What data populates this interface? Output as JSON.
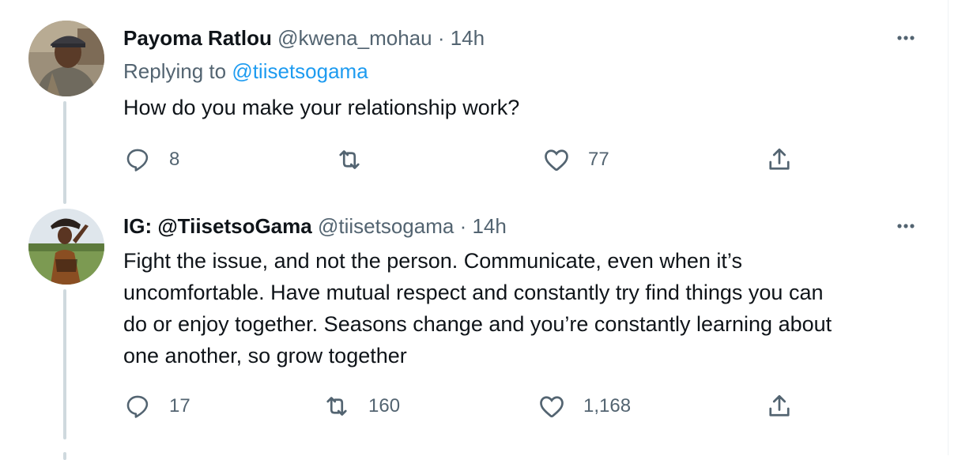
{
  "tweets": [
    {
      "name": "Payoma Ratlou",
      "handle": "@kwena_mohau",
      "separator": "·",
      "time": "14h",
      "replying_prefix": "Replying to",
      "replying_to": "@tiisetsogama",
      "text": "How do you make your relationship work?",
      "reply_count": "8",
      "retweet_count": "",
      "like_count": "77"
    },
    {
      "name": "IG: @TiisetsoGama",
      "handle": "@tiisetsogama",
      "separator": "·",
      "time": "14h",
      "text_lines": [
        "Fight the issue, and not the person. Communicate, even when it’s",
        "uncomfortable. Have mutual respect and constantly try find things you can",
        "do or enjoy together. Seasons change and you’re constantly learning about",
        "one another, so grow together"
      ],
      "reply_count": "17",
      "retweet_count": "160",
      "like_count": "1,168"
    }
  ],
  "colors": {
    "text": "#0f1419",
    "secondary": "#536471",
    "link": "#1d9bf0",
    "thread_line": "#cfd9de"
  },
  "icons": {
    "reply": "reply-icon",
    "retweet": "retweet-icon",
    "like": "heart-icon",
    "share": "share-icon",
    "more": "more-icon"
  }
}
